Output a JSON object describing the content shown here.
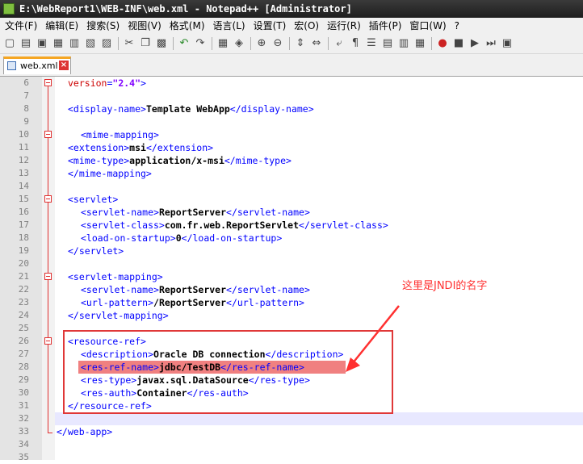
{
  "window": {
    "title": "E:\\WebReport1\\WEB-INF\\web.xml - Notepad++ [Administrator]"
  },
  "menu": [
    "文件(F)",
    "编辑(E)",
    "搜索(S)",
    "视图(V)",
    "格式(M)",
    "语言(L)",
    "设置(T)",
    "宏(O)",
    "运行(R)",
    "插件(P)",
    "窗口(W)",
    "?"
  ],
  "tab": {
    "label": "web.xml"
  },
  "annotation": {
    "text": "这里是JNDI的名字",
    "color": "#ff3030"
  },
  "colors": {
    "tag": "#0000ff",
    "text": "#000000",
    "attr": "#cc0000",
    "value": "#8000ff",
    "highlight": "#f08080",
    "annotation_box": "#e03838"
  },
  "lines": [
    {
      "n": "6",
      "indent": 1,
      "parts": [
        {
          "c": "attr",
          "t": "version"
        },
        {
          "c": "tag",
          "t": "="
        },
        {
          "c": "val",
          "t": "\"2.4\""
        },
        {
          "c": "tag",
          "t": ">"
        }
      ]
    },
    {
      "n": "7",
      "indent": 0,
      "parts": []
    },
    {
      "n": "8",
      "indent": 1,
      "parts": [
        {
          "c": "tag",
          "t": "<display-name>"
        },
        {
          "c": "txt",
          "t": "Template WebApp"
        },
        {
          "c": "tag",
          "t": "</display-name>"
        }
      ]
    },
    {
      "n": "9",
      "indent": 0,
      "parts": []
    },
    {
      "n": "10",
      "indent": 2,
      "parts": [
        {
          "c": "tag",
          "t": "<mime-mapping>"
        }
      ]
    },
    {
      "n": "11",
      "indent": 1,
      "parts": [
        {
          "c": "tag",
          "t": "<extension>"
        },
        {
          "c": "txt",
          "t": "msi"
        },
        {
          "c": "tag",
          "t": "</extension>"
        }
      ]
    },
    {
      "n": "12",
      "indent": 1,
      "parts": [
        {
          "c": "tag",
          "t": "<mime-type>"
        },
        {
          "c": "txt",
          "t": "application/x-msi"
        },
        {
          "c": "tag",
          "t": "</mime-type>"
        }
      ]
    },
    {
      "n": "13",
      "indent": 1,
      "parts": [
        {
          "c": "tag",
          "t": "</mime-mapping>"
        }
      ]
    },
    {
      "n": "14",
      "indent": 0,
      "parts": []
    },
    {
      "n": "15",
      "indent": 1,
      "parts": [
        {
          "c": "tag",
          "t": "<servlet>"
        }
      ]
    },
    {
      "n": "16",
      "indent": 2,
      "parts": [
        {
          "c": "tag",
          "t": "<servlet-name>"
        },
        {
          "c": "txt",
          "t": "ReportServer"
        },
        {
          "c": "tag",
          "t": "</servlet-name>"
        }
      ]
    },
    {
      "n": "17",
      "indent": 2,
      "parts": [
        {
          "c": "tag",
          "t": "<servlet-class>"
        },
        {
          "c": "txt",
          "t": "com.fr.web.ReportServlet"
        },
        {
          "c": "tag",
          "t": "</servlet-class>"
        }
      ]
    },
    {
      "n": "18",
      "indent": 2,
      "parts": [
        {
          "c": "tag",
          "t": "<load-on-startup>"
        },
        {
          "c": "txt",
          "t": "0"
        },
        {
          "c": "tag",
          "t": "</load-on-startup>"
        }
      ]
    },
    {
      "n": "19",
      "indent": 1,
      "parts": [
        {
          "c": "tag",
          "t": "</servlet>"
        }
      ]
    },
    {
      "n": "20",
      "indent": 0,
      "parts": []
    },
    {
      "n": "21",
      "indent": 1,
      "parts": [
        {
          "c": "tag",
          "t": "<servlet-mapping>"
        }
      ]
    },
    {
      "n": "22",
      "indent": 2,
      "parts": [
        {
          "c": "tag",
          "t": "<servlet-name>"
        },
        {
          "c": "txt",
          "t": "ReportServer"
        },
        {
          "c": "tag",
          "t": "</servlet-name>"
        }
      ]
    },
    {
      "n": "23",
      "indent": 2,
      "parts": [
        {
          "c": "tag",
          "t": "<url-pattern>"
        },
        {
          "c": "txt",
          "t": "/ReportServer"
        },
        {
          "c": "tag",
          "t": "</url-pattern>"
        }
      ]
    },
    {
      "n": "24",
      "indent": 1,
      "parts": [
        {
          "c": "tag",
          "t": "</servlet-mapping>"
        }
      ]
    },
    {
      "n": "25",
      "indent": 0,
      "parts": []
    },
    {
      "n": "26",
      "indent": 1,
      "parts": [
        {
          "c": "tag",
          "t": "<resource-ref>"
        }
      ]
    },
    {
      "n": "27",
      "indent": 2,
      "parts": [
        {
          "c": "tag",
          "t": "<description>"
        },
        {
          "c": "txt",
          "t": "Oracle DB connection"
        },
        {
          "c": "tag",
          "t": "</description>"
        }
      ]
    },
    {
      "n": "28",
      "indent": 2,
      "parts": [
        {
          "c": "tag",
          "t": "<res-ref-name>"
        },
        {
          "c": "txt",
          "t": "jdbc/TestDB"
        },
        {
          "c": "tag",
          "t": "</res-ref-name>"
        }
      ]
    },
    {
      "n": "29",
      "indent": 2,
      "parts": [
        {
          "c": "tag",
          "t": "<res-type>"
        },
        {
          "c": "txt",
          "t": "javax.sql.DataSource"
        },
        {
          "c": "tag",
          "t": "</res-type>"
        }
      ]
    },
    {
      "n": "30",
      "indent": 2,
      "parts": [
        {
          "c": "tag",
          "t": "<res-auth>"
        },
        {
          "c": "txt",
          "t": "Container"
        },
        {
          "c": "tag",
          "t": "</res-auth>"
        }
      ]
    },
    {
      "n": "31",
      "indent": 1,
      "parts": [
        {
          "c": "tag",
          "t": "</resource-ref>"
        }
      ]
    },
    {
      "n": "32",
      "indent": 0,
      "parts": []
    },
    {
      "n": "33",
      "indent": 0,
      "parts": [
        {
          "c": "tag",
          "t": "</web-app>"
        }
      ]
    },
    {
      "n": "34",
      "indent": 0,
      "parts": []
    },
    {
      "n": "35",
      "indent": 0,
      "parts": []
    }
  ]
}
